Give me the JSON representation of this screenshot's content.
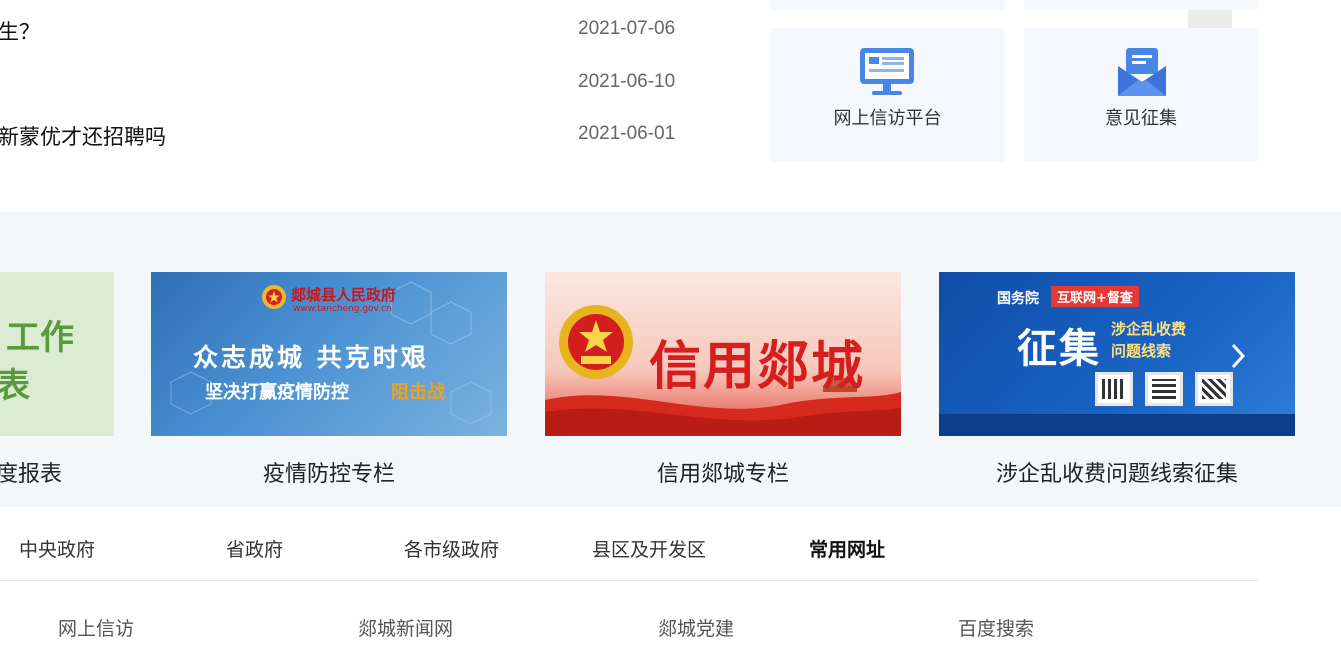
{
  "news": [
    {
      "title": "生？",
      "date": "2021-07-06"
    },
    {
      "title": "",
      "date": "2021-06-10"
    },
    {
      "title": "新蒙优才还招聘吗",
      "date": "2021-06-01"
    }
  ],
  "services": [
    {
      "label": "网上信访平台",
      "icon": "monitor-icon"
    },
    {
      "label": "意见征集",
      "icon": "envelope-icon"
    }
  ],
  "banners": [
    {
      "caption": "度报表",
      "image_text": [
        "工作",
        "表"
      ]
    },
    {
      "caption": "疫情防控专栏",
      "image_text": [
        "郯城县人民政府",
        "www.tancheng.gov.cn",
        "众志成城 共克时艰",
        "坚决打赢疫情防控",
        "阻击战"
      ]
    },
    {
      "caption": "信用郯城专栏",
      "image_text": [
        "信用郯城"
      ]
    },
    {
      "caption": "涉企乱收费问题线索征集",
      "image_text": [
        "国务院",
        "互联网+督查",
        "征集",
        "涉企乱收费",
        "问题线索"
      ]
    }
  ],
  "tabs": [
    {
      "label": "中央政府"
    },
    {
      "label": "省政府"
    },
    {
      "label": "各市级政府"
    },
    {
      "label": "县区及开发区"
    },
    {
      "label": "常用网址",
      "active": true
    }
  ],
  "links": [
    {
      "label": "网上信访"
    },
    {
      "label": "郯城新闻网"
    },
    {
      "label": "郯城党建"
    },
    {
      "label": "百度搜索"
    }
  ],
  "colors": {
    "band_bg": "#f4f7fa",
    "tile_bg": "#f5f8fc",
    "icon_blue": "#4a86e8",
    "credit_red": "#d61e1e",
    "notice_blue": "#1565c0"
  }
}
